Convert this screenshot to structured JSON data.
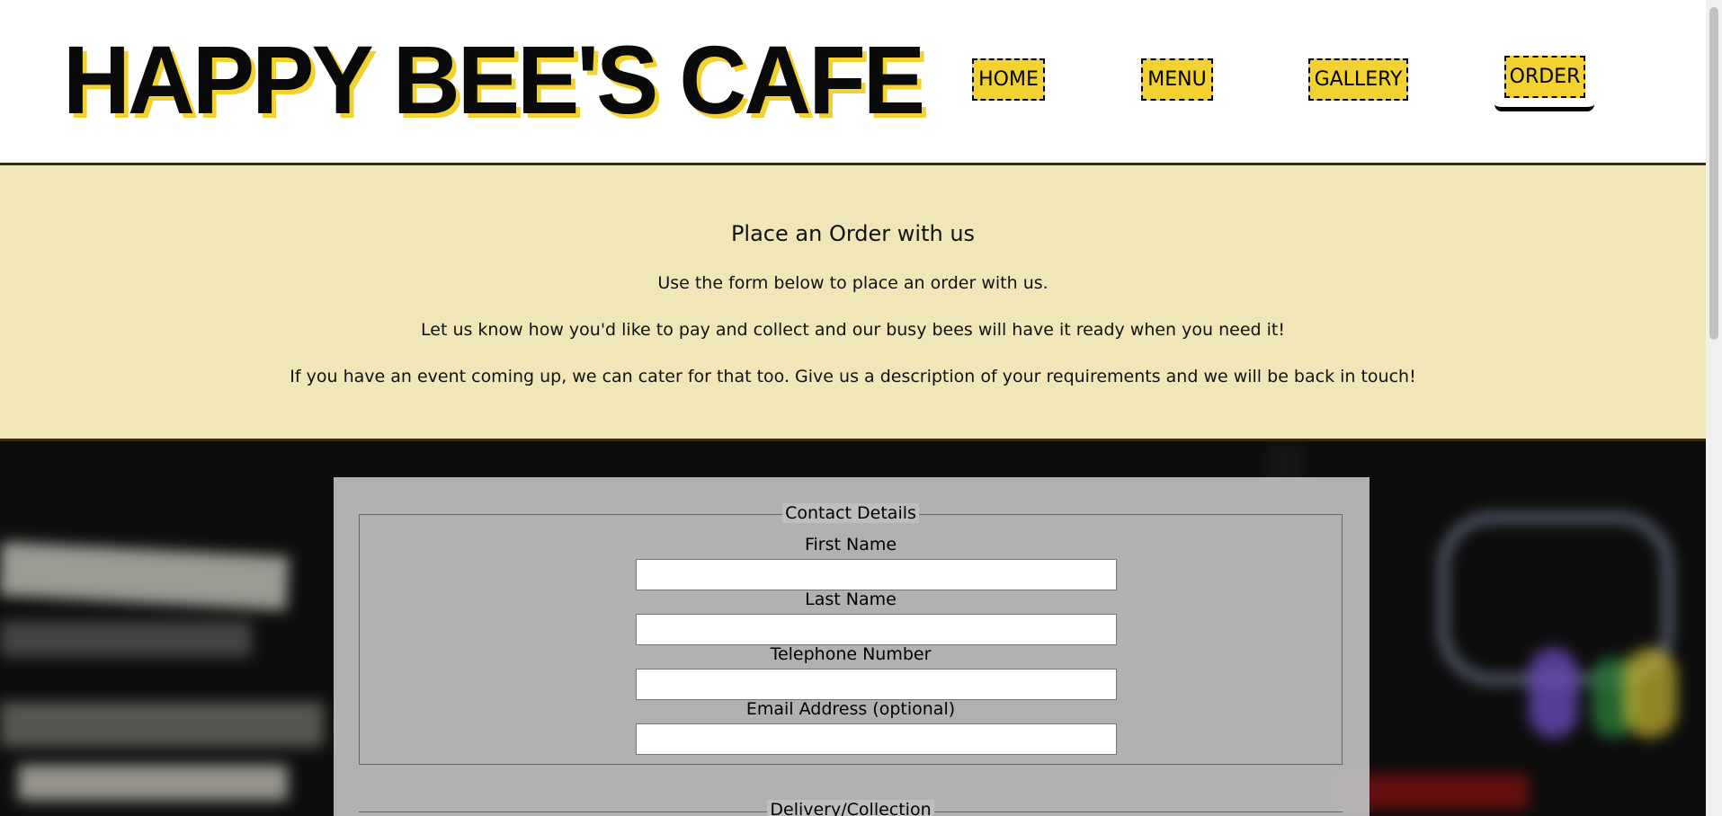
{
  "header": {
    "logo": "HAPPY BEE'S CAFE",
    "nav": {
      "home": "HOME",
      "menu": "MENU",
      "gallery": "GALLERY",
      "order": "ORDER"
    }
  },
  "intro": {
    "title": "Place an Order with us",
    "line1": "Use the form below to place an order with us.",
    "line2": "Let us know how you'd like to pay and collect and our busy bees will have it ready when you need it!",
    "line3": "If you have an event coming up, we can cater for that too. Give us a description of your requirements and we will be back in touch!"
  },
  "form": {
    "contact_legend": "Contact Details",
    "fields": {
      "first_name_label": "First Name",
      "last_name_label": "Last Name",
      "telephone_label": "Telephone Number",
      "email_label": "Email Address (optional)"
    },
    "delivery_legend": "Delivery/Collection"
  },
  "colors": {
    "accent_yellow": "#f2d230",
    "intro_bg": "#f1e6b8",
    "text": "#111111"
  }
}
